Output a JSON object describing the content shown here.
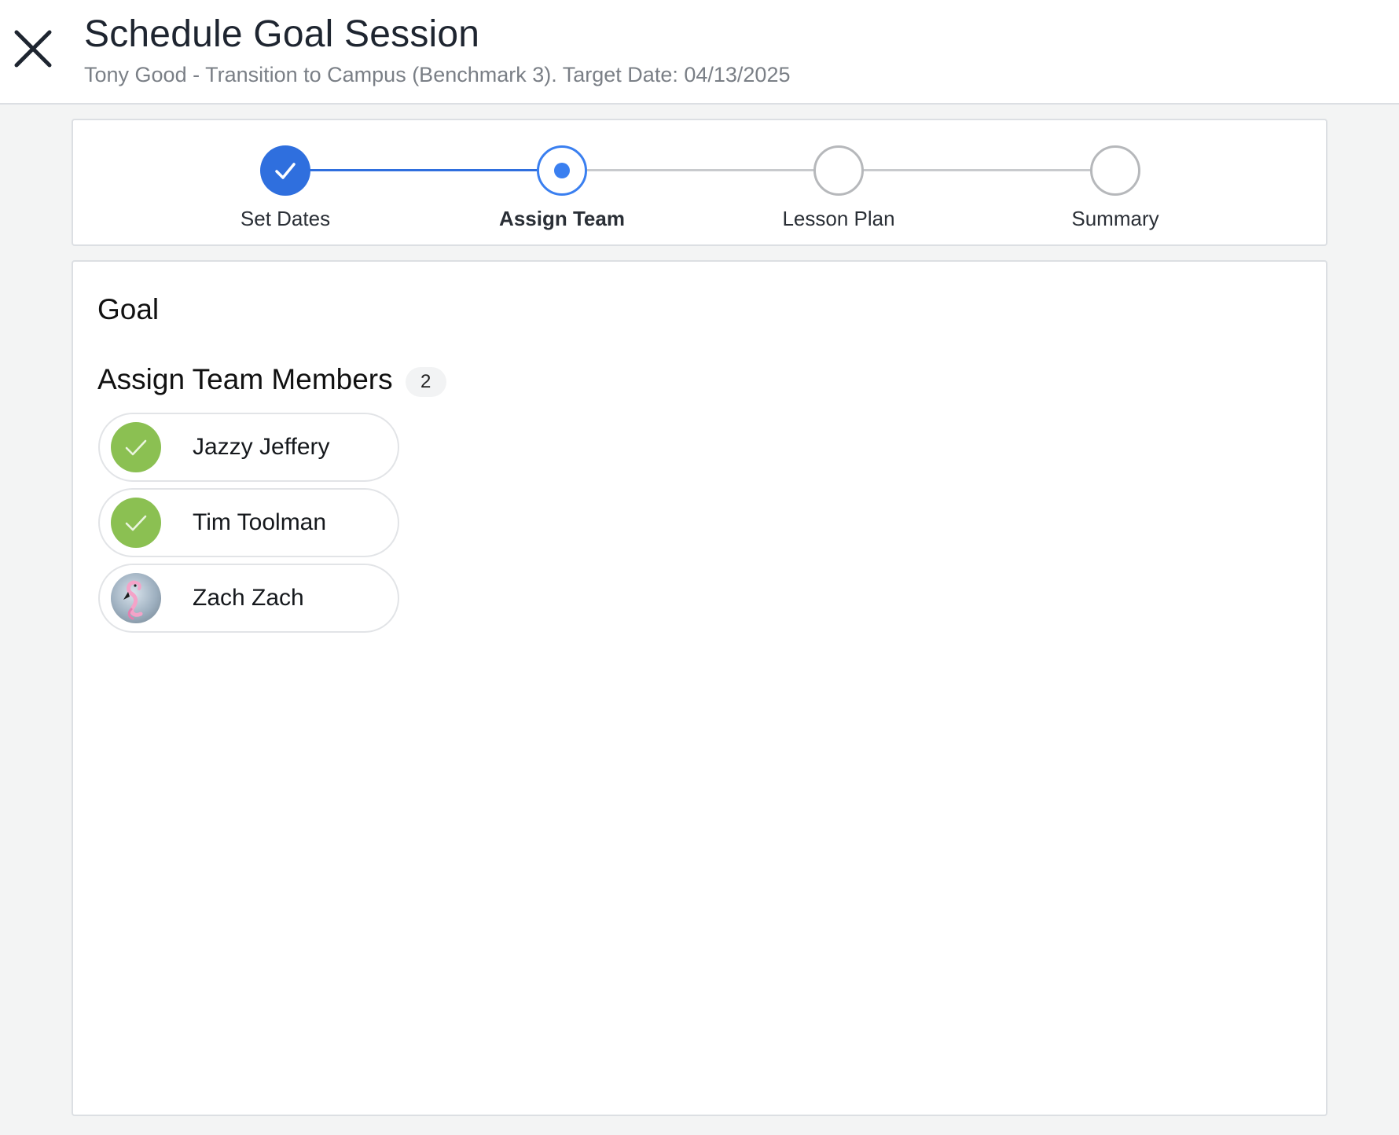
{
  "header": {
    "title": "Schedule Goal Session",
    "subtitle": "Tony Good - Transition to Campus (Benchmark 3). Target Date: 04/13/2025"
  },
  "stepper": {
    "steps": [
      {
        "label": "Set Dates",
        "state": "complete"
      },
      {
        "label": "Assign Team",
        "state": "current"
      },
      {
        "label": "Lesson Plan",
        "state": "pending"
      },
      {
        "label": "Summary",
        "state": "pending"
      }
    ]
  },
  "main": {
    "goal_heading": "Goal",
    "team_heading": "Assign Team Members",
    "selected_count": "2",
    "members": [
      {
        "name": "Jazzy Jeffery",
        "selected": true,
        "avatar": "check-icon"
      },
      {
        "name": "Tim Toolman",
        "selected": true,
        "avatar": "check-icon"
      },
      {
        "name": "Zach Zach",
        "selected": false,
        "avatar": "flamingo-photo"
      }
    ]
  },
  "colors": {
    "accent": "#2f6fde",
    "active_ring": "#3a7ff0",
    "selected_green": "#8bc052",
    "pending_gray": "#b6b8bb"
  }
}
